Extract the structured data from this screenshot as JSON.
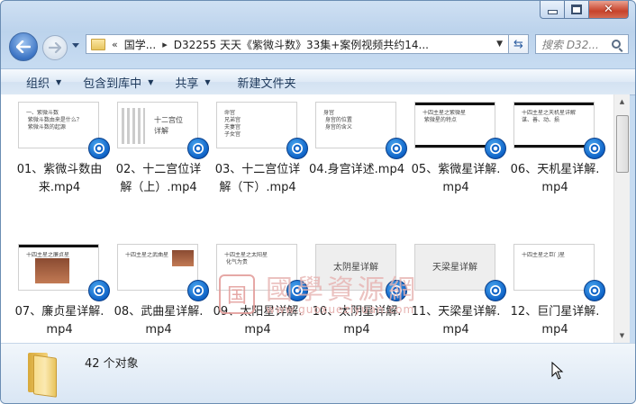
{
  "window": {
    "address": {
      "overflow_glyph": "«",
      "crumbs": [
        "国学...",
        "D32255 天天《紫微斗数》33集+案例视频共约14..."
      ]
    },
    "search_placeholder": "搜索 D32...",
    "caption": {
      "close_glyph": "✕"
    }
  },
  "toolbar": {
    "organize": "组织",
    "include_library": "包含到库中",
    "share": "共享",
    "new_folder": "新建文件夹"
  },
  "files": [
    {
      "name": "01、紫微斗数由来.mp4",
      "line1": "01、紫微斗数由",
      "line2": "来.mp4",
      "thumb_text": "一、紫微斗数\n 紫微斗数由来是什么？\n 紫微斗数的起源"
    },
    {
      "name": "02、十二宫位详解（上）.mp4",
      "line1": "02、十二宫位详",
      "line2": "解（上）.mp4",
      "thumb_text": "十二宫位\n详解"
    },
    {
      "name": "03、十二宫位详解（下）.mp4",
      "line1": "03、十二宫位详",
      "line2": "解（下）.mp4",
      "thumb_text": "命宫\n兄弟宫\n夫妻宫\n子女宫"
    },
    {
      "name": "04.身宫详述.mp4",
      "line1": "04.身宫详述.mp4",
      "line2": "",
      "thumb_text": "身宫\n 身宫的位置\n 身宫的含义"
    },
    {
      "name": "05、紫微星详解.mp4",
      "line1": "05、紫微星详解.",
      "line2": "mp4",
      "thumb_text": "十四主星之紫微星\n 紫微星的特点"
    },
    {
      "name": "06、天机星详解.mp4",
      "line1": "06、天机星详解.",
      "line2": "mp4",
      "thumb_text": "十四主星之天机星详解\n谋、善、动、损"
    },
    {
      "name": "07、廉贞星详解.mp4",
      "line1": "07、廉贞星详解.",
      "line2": "mp4",
      "thumb_text": "十四主星之廉贞星"
    },
    {
      "name": "08、武曲星详解.mp4",
      "line1": "08、武曲星详解.",
      "line2": "mp4",
      "thumb_text": "十四主星之武曲星"
    },
    {
      "name": "09、太阳星详解.mp4",
      "line1": "09、太阳星详解.",
      "line2": "mp4",
      "thumb_text": "十四主星之太阳星\n 化气为贵"
    },
    {
      "name": "10、太阴星详解.mp4",
      "line1": "10、太阴星详解.",
      "line2": "mp4",
      "thumb_text": "太阴星详解"
    },
    {
      "name": "11、天梁星详解.mp4",
      "line1": "11、天梁星详解.",
      "line2": "mp4",
      "thumb_text": "天梁星详解"
    },
    {
      "name": "12、巨门星详解.mp4",
      "line1": "12、巨门星详解.",
      "line2": "mp4",
      "thumb_text": "十四主星之巨门星"
    }
  ],
  "watermark": {
    "seal": "国",
    "text": "國學資源網",
    "url": "www.guoxueziyuan.com"
  },
  "status": {
    "count": "42 个对象"
  }
}
